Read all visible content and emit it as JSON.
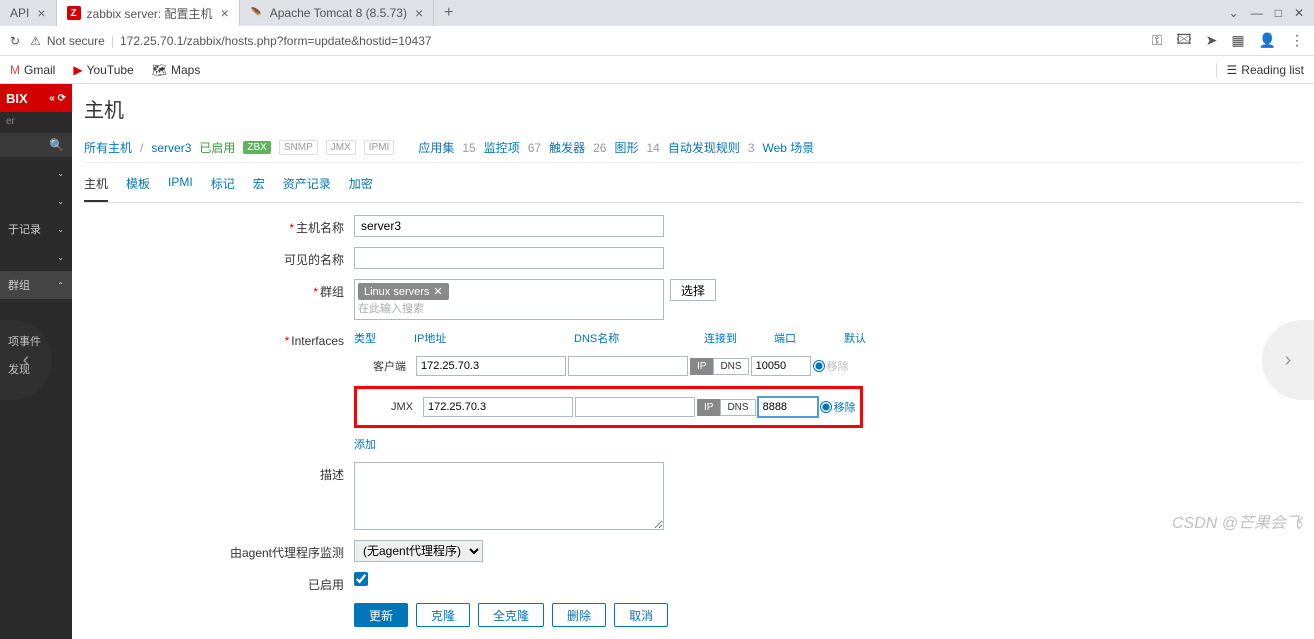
{
  "browser": {
    "tabs": [
      {
        "title": "API",
        "active": false
      },
      {
        "title": "zabbix server: 配置主机",
        "active": true,
        "icon": "Z"
      },
      {
        "title": "Apache Tomcat 8 (8.5.73)",
        "active": false
      }
    ],
    "window_controls": {
      "min": "—",
      "max": "□",
      "close": "✕",
      "expand": "⌄"
    },
    "url_security": "Not secure",
    "url": "172.25.70.1/zabbix/hosts.php?form=update&hostid=10437",
    "reload": "↻",
    "icons": {
      "key": "⚿",
      "translate": "☆",
      "send": "➤",
      "puzzle": "🧩",
      "avatar": "👤",
      "menu": "⋮"
    },
    "bookmarks": {
      "gmail": "Gmail",
      "youtube": "YouTube",
      "maps": "Maps",
      "reading": "Reading list"
    }
  },
  "sidebar": {
    "logo": "BIX",
    "collapse": "«  ⟳",
    "label": "er",
    "items": [
      "",
      "",
      "于记录",
      "",
      "群组",
      "",
      "项事件",
      "发现",
      ""
    ]
  },
  "page": {
    "title": "主机",
    "breadcrumb": {
      "all": "所有主机",
      "host": "server3",
      "enabled": "已启用"
    },
    "badges": {
      "zbx": "ZBX",
      "snmp": "SNMP",
      "jmx": "JMX",
      "ipmi": "IPMI"
    },
    "nav_items": [
      {
        "label": "应用集",
        "count": "15"
      },
      {
        "label": "监控项",
        "count": "67"
      },
      {
        "label": "触发器",
        "count": "26"
      },
      {
        "label": "图形",
        "count": "14"
      },
      {
        "label": "自动发现规则",
        "count": "3"
      },
      {
        "label": "Web 场景",
        "count": ""
      }
    ],
    "form_tabs": [
      "主机",
      "模板",
      "IPMI",
      "标记",
      "宏",
      "资产记录",
      "加密"
    ]
  },
  "form": {
    "hostname_label": "主机名称",
    "hostname": "server3",
    "visible_name_label": "可见的名称",
    "visible_name": "",
    "groups_label": "群组",
    "group_tag": "Linux servers",
    "group_placeholder": "在此输入搜索",
    "choose": "选择",
    "interfaces_label": "Interfaces",
    "iface_headers": {
      "type": "类型",
      "ip": "IP地址",
      "dns": "DNS名称",
      "connect": "连接到",
      "port": "端口",
      "default": "默认"
    },
    "iface_agent": {
      "type": "客户端",
      "ip": "172.25.70.3",
      "dns": "",
      "ip_btn": "IP",
      "dns_btn": "DNS",
      "port": "10050",
      "remove": "移除"
    },
    "iface_jmx": {
      "type": "JMX",
      "ip": "172.25.70.3",
      "dns": "",
      "ip_btn": "IP",
      "dns_btn": "DNS",
      "port": "8888",
      "remove": "移除"
    },
    "add_link": "添加",
    "description_label": "描述",
    "description": "",
    "proxy_label": "由agent代理程序监测",
    "proxy_value": "(无agent代理程序)",
    "enabled_label": "已启用",
    "buttons": {
      "update": "更新",
      "clone": "克隆",
      "full_clone": "全克隆",
      "delete": "删除",
      "cancel": "取消"
    }
  },
  "watermark": "CSDN @芒果会飞"
}
